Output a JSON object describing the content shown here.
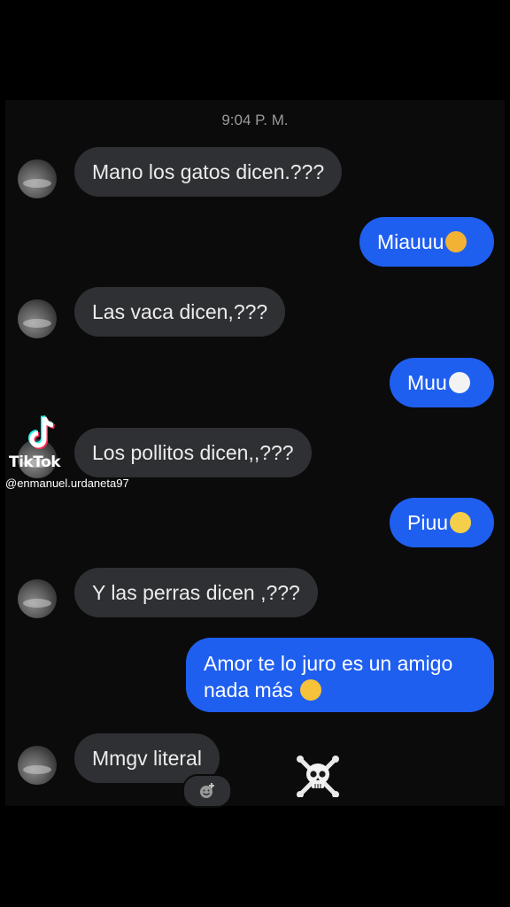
{
  "conversation": {
    "timestamp": "9:04 P. M.",
    "messages": [
      {
        "side": "in",
        "text": "Mano los gatos dicen.???"
      },
      {
        "side": "out",
        "text": "Miauuu",
        "emoji": "smirking-cat-emoji"
      },
      {
        "side": "in",
        "text": "Las vaca dicen,???"
      },
      {
        "side": "out",
        "text": "Muu",
        "emoji": "cow-emoji"
      },
      {
        "side": "in",
        "text": "Los pollitos dicen,,???"
      },
      {
        "side": "out",
        "text": "Piuu",
        "emoji": "hatching-chick-emoji"
      },
      {
        "side": "in",
        "text": "Y las perras dicen ,???"
      },
      {
        "side": "out",
        "text_line1": "Amor te lo juro es un amigo",
        "text_line2": "nada más",
        "emoji": "grinning-sweat-emoji"
      },
      {
        "side": "in",
        "text": "Mmgv literal"
      }
    ],
    "reaction_icon": "add-reaction-icon",
    "overlay_icon": "skull-crossbones-icon"
  },
  "watermark": {
    "brand": "TikTok",
    "handle": "@enmanuel.urdaneta97"
  },
  "colors": {
    "background": "#000000",
    "incoming_bubble": "#2f3033",
    "outgoing_bubble": "#1f5ff0",
    "timestamp": "#9a9a9a"
  }
}
